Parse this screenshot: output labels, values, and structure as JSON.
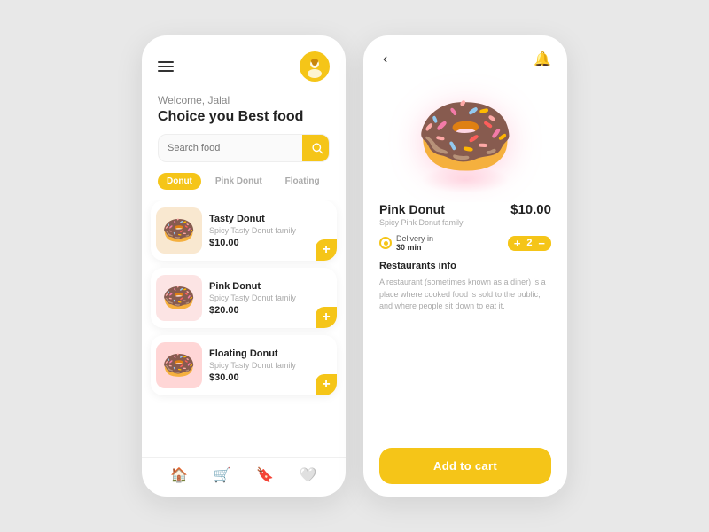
{
  "leftCard": {
    "greeting": "Welcome, Jalal",
    "headline": "Choice you Best food",
    "search": {
      "placeholder": "Search food",
      "buttonLabel": "search"
    },
    "filterTabs": [
      {
        "id": "donut",
        "label": "Donut",
        "active": true
      },
      {
        "id": "pink-donut",
        "label": "Pink Donut",
        "active": false
      },
      {
        "id": "floating",
        "label": "Floating",
        "active": false
      }
    ],
    "foodItems": [
      {
        "name": "Tasty Donut",
        "desc": "Spicy Tasty Donut family",
        "price": "$10.00",
        "emoji": "🍩",
        "bg": "bg1"
      },
      {
        "name": "Pink Donut",
        "desc": "Spicy Tasty Donut family",
        "price": "$20.00",
        "emoji": "🍩",
        "bg": "bg2"
      },
      {
        "name": "Floating Donut",
        "desc": "Spicy Tasty Donut family",
        "price": "$30.00",
        "emoji": "🍩",
        "bg": "bg3"
      }
    ],
    "bottomNav": [
      {
        "icon": "🏠",
        "active": true,
        "name": "home"
      },
      {
        "icon": "🛒",
        "active": false,
        "name": "cart"
      },
      {
        "icon": "🔖",
        "active": false,
        "name": "bookmark"
      },
      {
        "icon": "🤍",
        "active": false,
        "name": "favorites"
      }
    ]
  },
  "rightCard": {
    "backLabel": "‹",
    "product": {
      "name": "Pink Donut",
      "desc": "Spicy Pink Donut family",
      "price": "$10.00",
      "emoji": "🍩"
    },
    "delivery": {
      "label": "Delivery in",
      "time": "30 min"
    },
    "quantity": 2,
    "restaurantsTitle": "Restaurants info",
    "restaurantsDesc": "A restaurant (sometimes known as a diner) is a place where cooked food is sold to the public, and where people sit down to eat it.",
    "addToCartLabel": "Add to cart"
  }
}
